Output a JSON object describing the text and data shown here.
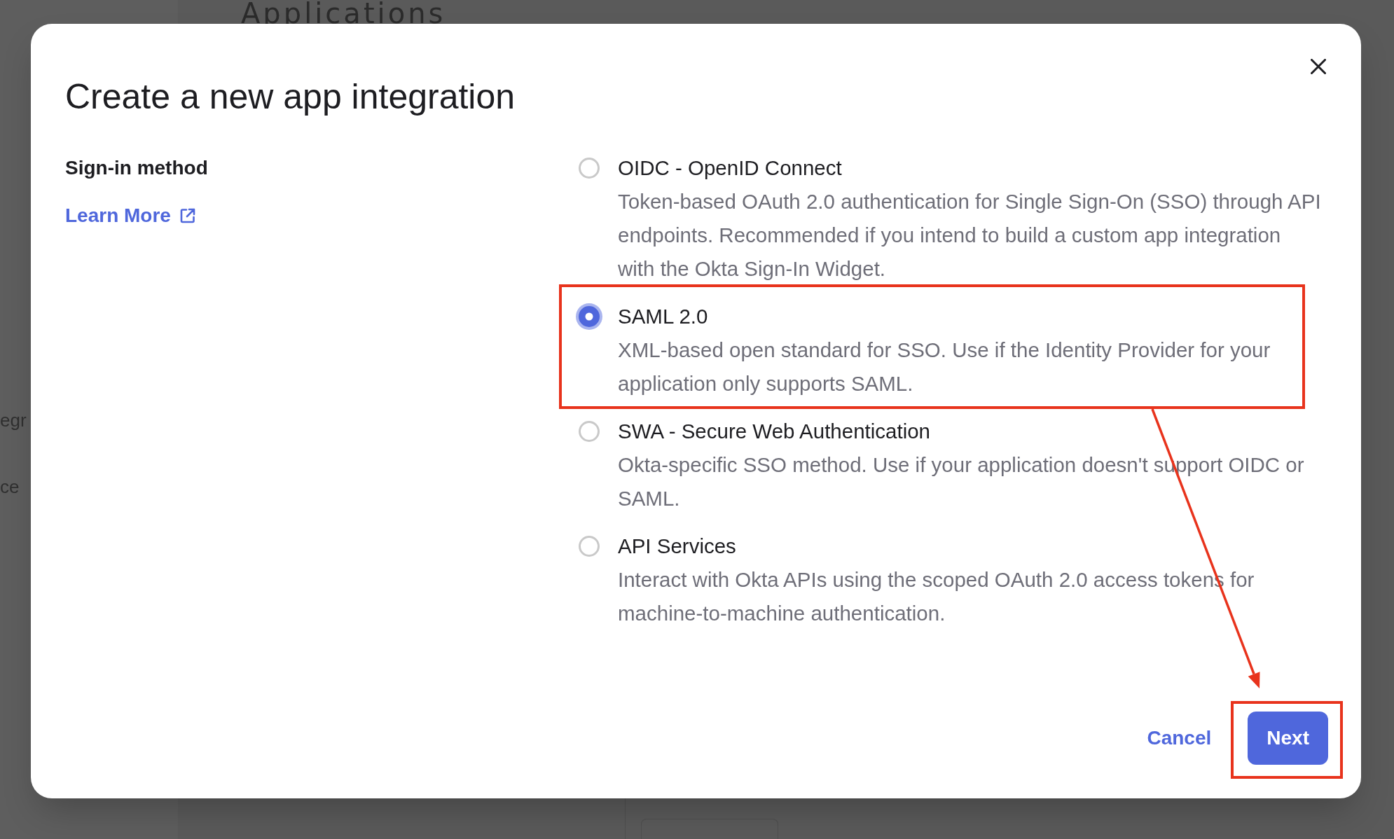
{
  "background": {
    "heading": "Applications",
    "sidebar_texts": [
      "egr",
      "ce"
    ]
  },
  "dialog": {
    "title": "Create a new app integration",
    "section_label": "Sign-in method",
    "learn_more": "Learn More",
    "options": [
      {
        "label": "OIDC - OpenID Connect",
        "description": "Token-based OAuth 2.0 authentication for Single Sign-On (SSO) through API endpoints. Recommended if you intend to build a custom app integration with the Okta Sign-In Widget.",
        "selected": false,
        "highlighted": false
      },
      {
        "label": "SAML 2.0",
        "description": "XML-based open standard for SSO. Use if the Identity Provider for your application only supports SAML.",
        "selected": true,
        "highlighted": true
      },
      {
        "label": "SWA - Secure Web Authentication",
        "description": "Okta-specific SSO method. Use if your application doesn't support OIDC or SAML.",
        "selected": false,
        "highlighted": false
      },
      {
        "label": "API Services",
        "description": "Interact with Okta APIs using the scoped OAuth 2.0 access tokens for machine-to-machine authentication.",
        "selected": false,
        "highlighted": false
      }
    ],
    "buttons": [
      {
        "label": "Cancel",
        "kind": "link",
        "highlighted": false
      },
      {
        "label": "Next",
        "kind": "primary",
        "highlighted": true
      }
    ]
  }
}
